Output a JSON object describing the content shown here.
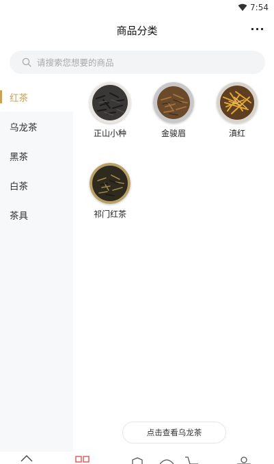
{
  "status_bar": {
    "time": "7:54"
  },
  "header": {
    "title": "商品分类",
    "more_label": "···"
  },
  "search": {
    "placeholder": "请搜索您想要的商品"
  },
  "sidebar": {
    "items": [
      {
        "label": "红茶",
        "active": true
      },
      {
        "label": "乌龙茶",
        "active": false
      },
      {
        "label": "黑茶",
        "active": false
      },
      {
        "label": "白茶",
        "active": false
      },
      {
        "label": "茶具",
        "active": false
      }
    ]
  },
  "products": [
    {
      "name": "正山小种"
    },
    {
      "name": "金骏眉"
    },
    {
      "name": "滇红"
    },
    {
      "name": "祁门红茶"
    }
  ],
  "next_category_button": {
    "label": "点击查看乌龙茶"
  },
  "colors": {
    "accent": "#c9a255",
    "sidebar_bg": "#f7f8fa",
    "tab_active": "#e0544f"
  },
  "tabbar": {
    "icons": [
      "home-icon",
      "category-icon",
      "discover-icon",
      "community-icon",
      "cart-icon",
      "profile-icon"
    ]
  }
}
